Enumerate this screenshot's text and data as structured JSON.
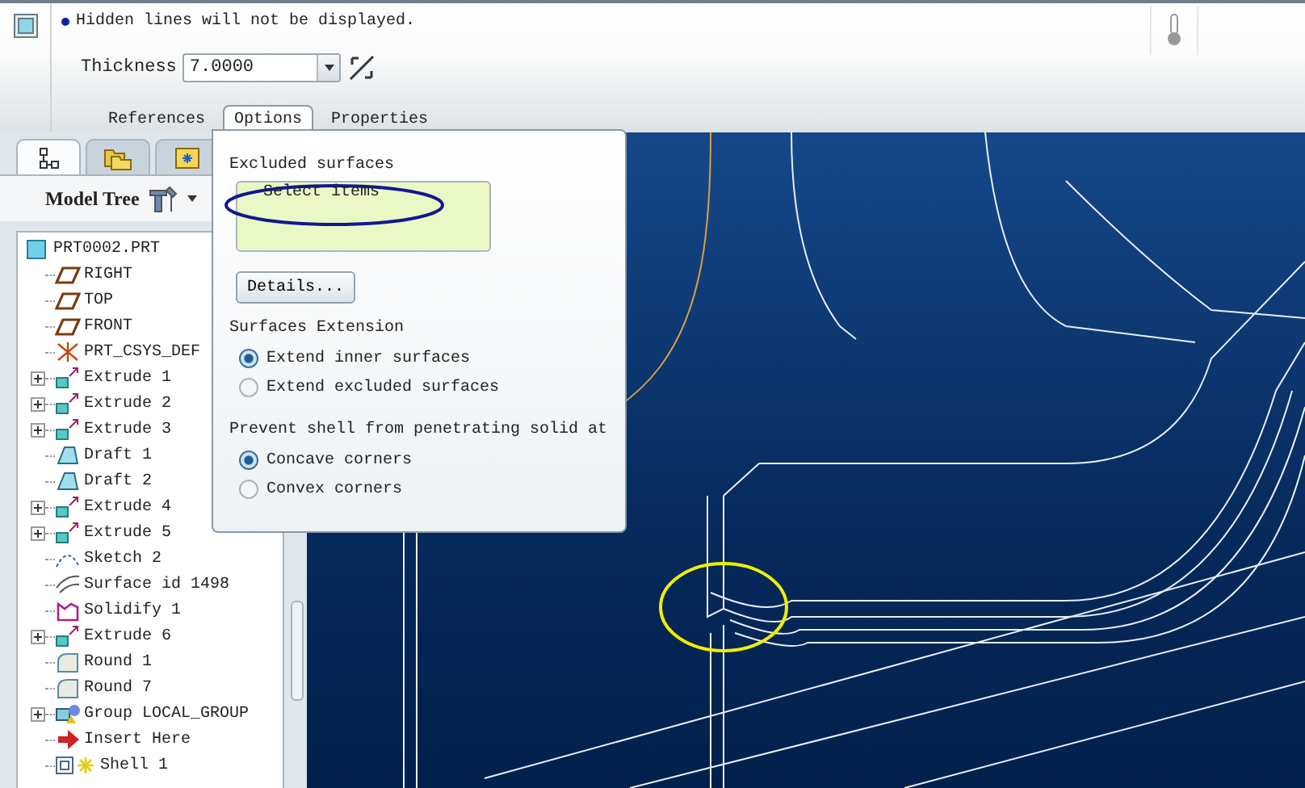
{
  "dashboard": {
    "message": "Hidden lines will not be displayed.",
    "thickness_label": "Thickness",
    "thickness_value": "7.0000",
    "tabs": [
      {
        "label": "References",
        "selected": false
      },
      {
        "label": "Options",
        "selected": true
      },
      {
        "label": "Properties",
        "selected": false
      }
    ]
  },
  "navigator_tabs": [
    {
      "kind": "tree",
      "selected": true
    },
    {
      "kind": "folders",
      "selected": false
    },
    {
      "kind": "favorites",
      "selected": false
    }
  ],
  "model_tree": {
    "title": "Model Tree",
    "root": {
      "label": "PRT0002.PRT",
      "kind": "part",
      "children": [
        {
          "label": "RIGHT",
          "kind": "plane",
          "expandable": false
        },
        {
          "label": "TOP",
          "kind": "plane",
          "expandable": false
        },
        {
          "label": "FRONT",
          "kind": "plane",
          "expandable": false
        },
        {
          "label": "PRT_CSYS_DEF",
          "kind": "csys",
          "expandable": false
        },
        {
          "label": "Extrude 1",
          "kind": "extrude",
          "expandable": true
        },
        {
          "label": "Extrude 2",
          "kind": "extrude",
          "expandable": true
        },
        {
          "label": "Extrude 3",
          "kind": "extrude",
          "expandable": true
        },
        {
          "label": "Draft 1",
          "kind": "draft",
          "expandable": false
        },
        {
          "label": "Draft 2",
          "kind": "draft",
          "expandable": false
        },
        {
          "label": "Extrude 4",
          "kind": "extrude",
          "expandable": true
        },
        {
          "label": "Extrude 5",
          "kind": "extrude",
          "expandable": true
        },
        {
          "label": "Sketch 2",
          "kind": "sketch",
          "expandable": false
        },
        {
          "label": "Surface id 1498",
          "kind": "surface",
          "expandable": false
        },
        {
          "label": "Solidify 1",
          "kind": "solidify",
          "expandable": false
        },
        {
          "label": "Extrude 6",
          "kind": "extrude",
          "expandable": true
        },
        {
          "label": "Round 1",
          "kind": "round",
          "expandable": false
        },
        {
          "label": "Round 7",
          "kind": "round",
          "expandable": false
        },
        {
          "label": "Group LOCAL_GROUP",
          "kind": "group",
          "expandable": true
        },
        {
          "label": "Insert Here",
          "kind": "insert",
          "expandable": false
        },
        {
          "label": "Shell 1",
          "kind": "shell",
          "expandable": false
        }
      ]
    }
  },
  "options_panel": {
    "excluded_label": "Excluded surfaces",
    "excluded_placeholder": "Select items",
    "details_button": "Details...",
    "extension_label": "Surfaces Extension",
    "extension_options": [
      {
        "label": "Extend inner surfaces",
        "selected": true
      },
      {
        "label": "Extend excluded surfaces",
        "selected": false
      }
    ],
    "prevent_label": "Prevent shell from penetrating solid at",
    "prevent_options": [
      {
        "label": "Concave corners",
        "selected": true
      },
      {
        "label": "Convex corners",
        "selected": false
      }
    ]
  }
}
